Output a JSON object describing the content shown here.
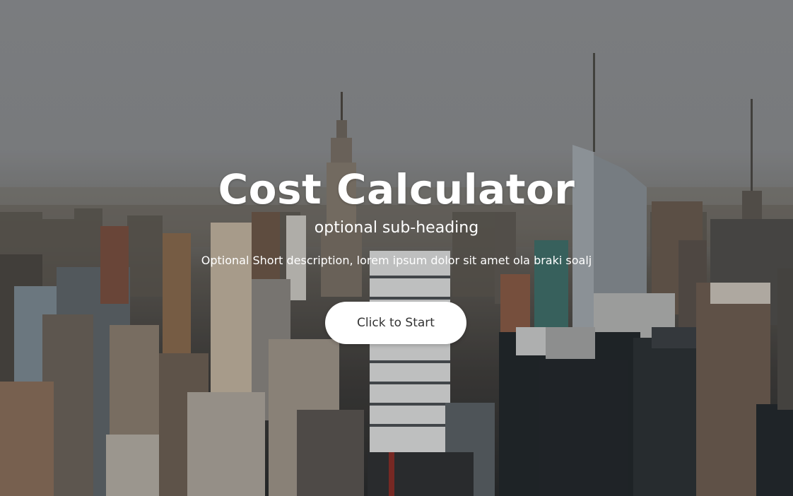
{
  "hero": {
    "title": "Cost Calculator",
    "subtitle": "optional sub-heading",
    "description": "Optional Short description, lorem ipsum dolor sit amet ola braki soalj",
    "start_button_label": "Click to Start"
  },
  "colors": {
    "text": "#ffffff",
    "button_background": "#ffffff",
    "button_text": "#333333",
    "sky": "#8f9094"
  },
  "background": {
    "image": "city-skyline-photo"
  }
}
